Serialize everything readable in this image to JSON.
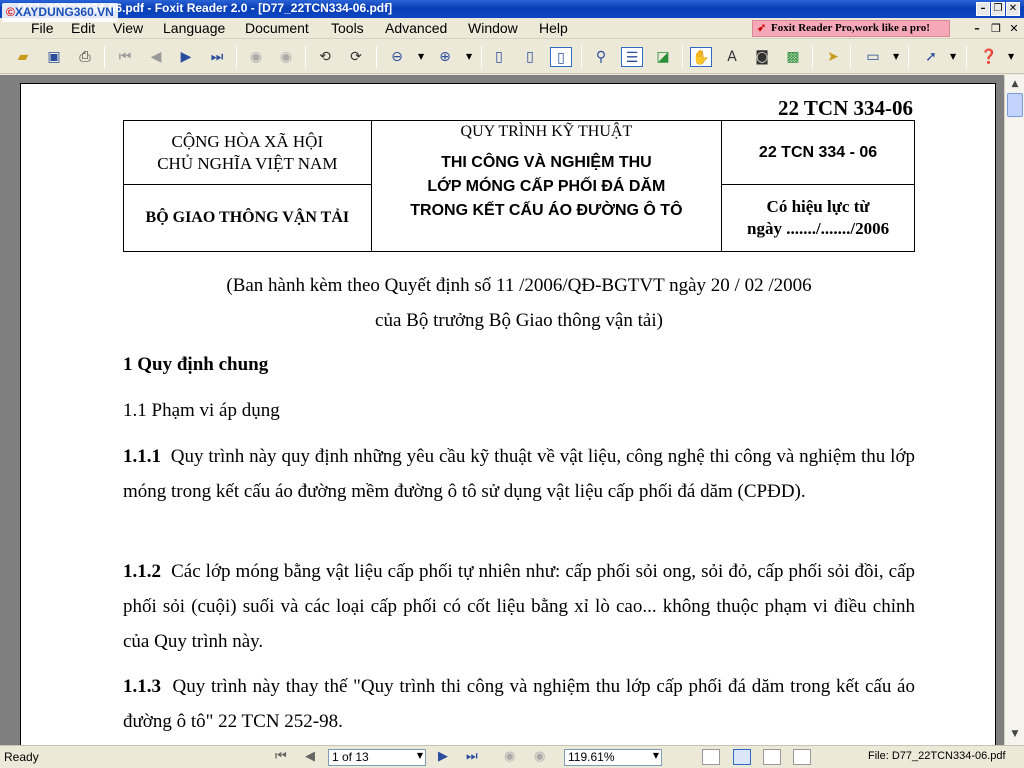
{
  "window": {
    "title": "D77_22TCN334-06.pdf - Foxit Reader 2.0 - [D77_22TCN334-06.pdf]",
    "watermark": "XAYDUNG360.VN"
  },
  "menu": {
    "items": [
      "File",
      "Edit",
      "View",
      "Language",
      "Document",
      "Tools",
      "Advanced",
      "Window",
      "Help"
    ],
    "promo": "Foxit Reader Pro,work like a pro!"
  },
  "toolbar": {
    "icons": [
      "open-icon",
      "save-icon",
      "print-icon",
      "first-page-icon",
      "prev-page-icon",
      "next-page-icon",
      "last-page-icon",
      "back-icon",
      "forward-icon",
      "rotate-left-icon",
      "rotate-right-icon",
      "zoom-out-icon",
      "zoom-in-icon",
      "actual-size-icon",
      "fit-page-icon",
      "fit-width-icon",
      "find-icon",
      "continuous-icon",
      "facing-icon",
      "hand-tool-icon",
      "text-select-icon",
      "snapshot-icon",
      "image-icon",
      "select-icon",
      "annotation-icon",
      "arrow-tool-icon",
      "help-icon"
    ]
  },
  "document": {
    "code": "22 TCN 334-06",
    "header": {
      "left_top": [
        "CỘNG HÒA XÃ HỘI",
        "CHỦ NGHĨA VIỆT NAM"
      ],
      "left_bottom": "BỘ GIAO THÔNG VẬN TẢI",
      "middle_sub": "QUY TRÌNH KỸ THUẬT",
      "middle_title": [
        "THI CÔNG VÀ NGHIỆM THU",
        "LỚP MÓNG CẤP PHỐI ĐÁ DĂM",
        "TRONG KẾT CẤU ÁO ĐƯỜNG Ô TÔ"
      ],
      "right_top": "22 TCN 334 - 06",
      "right_bottom": [
        "Có hiệu lực từ",
        "ngày ......./......./2006"
      ]
    },
    "decree": [
      "(Ban hành kèm theo Quyết định số    11  /2006/QĐ-BGTVT ngày   20 /  02 /2006",
      "của Bộ trưởng Bộ Giao thông vận tải)"
    ],
    "section1": "1  Quy định chung",
    "section11": "1.1  Phạm vi áp dụng",
    "p111": {
      "num": "1.1.1",
      "text": "Quy trình này quy định những yêu cầu kỹ thuật về vật liệu, công nghệ thi công và nghiệm thu lớp móng trong kết cấu áo đường mềm đường ô tô sử dụng vật liệu cấp phối đá dăm (CPĐD)."
    },
    "p112": {
      "num": "1.1.2",
      "text": "Các lớp móng bằng vật liệu cấp phối tự nhiên như: cấp phối sỏi ong, sỏi đỏ, cấp phối sỏi đồi, cấp phối sỏi (cuội) suối và các loại cấp phối có cốt liệu bằng xỉ lò cao... không thuộc phạm vi điều chỉnh của Quy trình này."
    },
    "p113": {
      "num": "1.1.3",
      "text": "Quy trình này thay thế \"Quy trình thi công và nghiệm thu lớp cấp phối đá dăm trong kết cấu áo đường ô tô\" 22 TCN 252-98."
    }
  },
  "statusbar": {
    "ready": "Ready",
    "page": "1 of 13",
    "zoom": "119.61%",
    "file": "File: D77_22TCN334-06.pdf"
  }
}
